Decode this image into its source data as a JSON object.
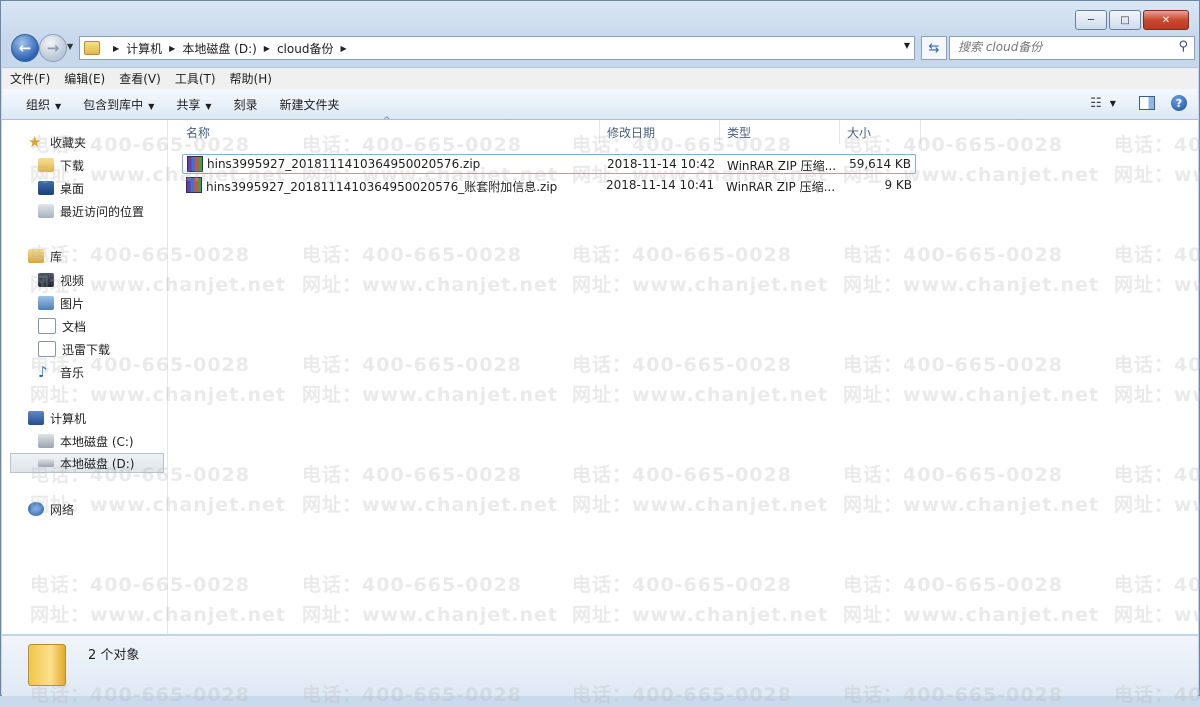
{
  "window": {
    "minimize": "─",
    "maximize": "□",
    "close": "✕"
  },
  "address": {
    "breadcrumbs": [
      "计算机",
      "本地磁盘 (D:)",
      "cloud备份"
    ]
  },
  "search": {
    "placeholder": "搜索 cloud备份"
  },
  "menu": [
    "文件(F)",
    "编辑(E)",
    "查看(V)",
    "工具(T)",
    "帮助(H)"
  ],
  "commands": {
    "organize": "组织",
    "include_library": "包含到库中",
    "share": "共享",
    "burn": "刻录",
    "new_folder": "新建文件夹"
  },
  "nav": {
    "favorites": "收藏夹",
    "downloads": "下载",
    "desktop": "桌面",
    "recent": "最近访问的位置",
    "libraries": "库",
    "videos": "视频",
    "pictures": "图片",
    "documents": "文档",
    "thunder": "迅雷下载",
    "music": "音乐",
    "computer": "计算机",
    "drive_c": "本地磁盘 (C:)",
    "drive_d": "本地磁盘 (D:)",
    "network": "网络"
  },
  "columns": {
    "name": "名称",
    "modified": "修改日期",
    "type": "类型",
    "size": "大小"
  },
  "files": [
    {
      "name": "hins3995927_2018111410364950020576.zip",
      "modified": "2018-11-14 10:42",
      "type": "WinRAR ZIP 压缩...",
      "size": "59,614 KB"
    },
    {
      "name": "hins3995927_2018111410364950020576_账套附加信息.zip",
      "modified": "2018-11-14 10:41",
      "type": "WinRAR ZIP 压缩...",
      "size": "9 KB"
    }
  ],
  "status": {
    "count_text": "2 个对象"
  },
  "watermark": {
    "phone": "电话：400-665-0028",
    "site": "网址：www.chanjet.net"
  }
}
